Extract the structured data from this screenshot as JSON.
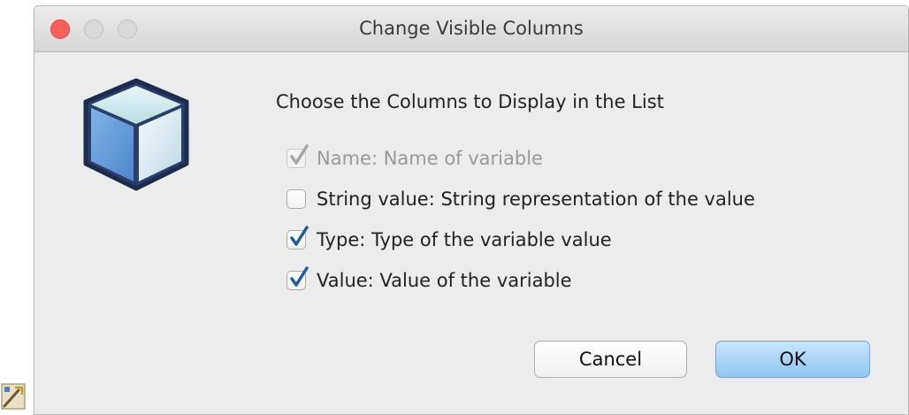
{
  "window": {
    "title": "Change Visible Columns"
  },
  "main": {
    "heading": "Choose the Columns to Display in the List",
    "options": [
      {
        "label": "Name: Name of variable",
        "checked": true,
        "disabled": true
      },
      {
        "label": "String value: String representation of the value",
        "checked": false,
        "disabled": false
      },
      {
        "label": "Type: Type of the variable value",
        "checked": true,
        "disabled": false
      },
      {
        "label": "Value: Value of the variable",
        "checked": true,
        "disabled": false
      }
    ]
  },
  "buttons": {
    "cancel_label": "Cancel",
    "ok_label": "OK"
  },
  "icons": {
    "app": "cube-icon",
    "corner": "tool-icon"
  },
  "colors": {
    "close": "#fc605b",
    "check": "#1f5d9f",
    "ok_button": "#8fc6f3"
  }
}
